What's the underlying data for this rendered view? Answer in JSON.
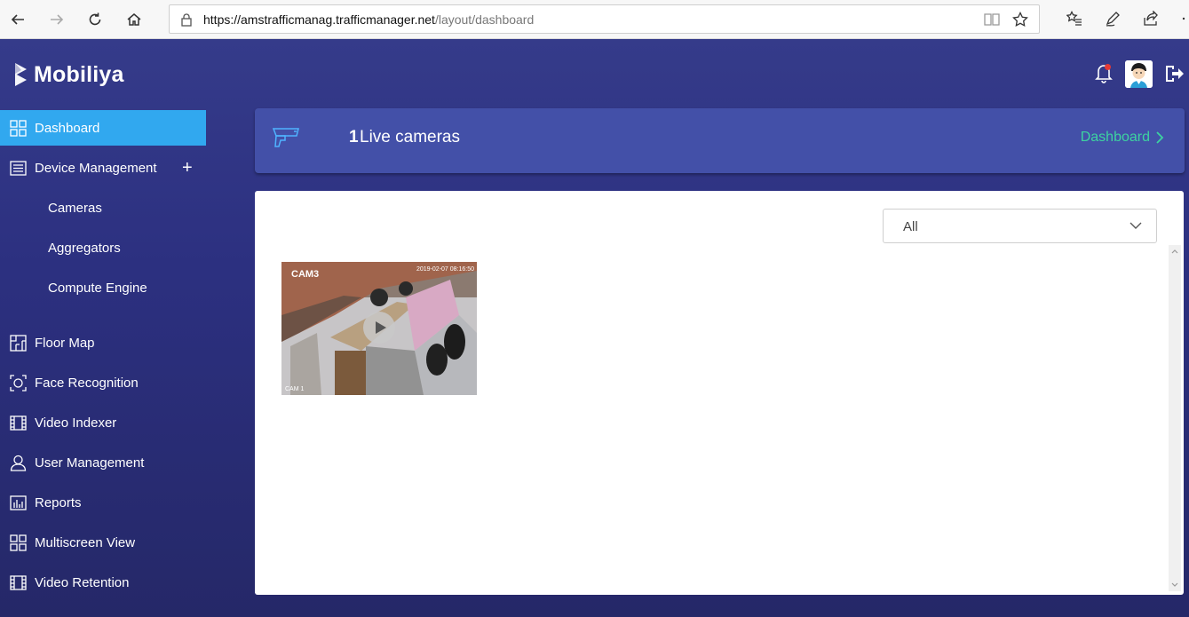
{
  "browser": {
    "url_host": "https://amstrafficmanag.trafficmanager.net",
    "url_path": "/layout/dashboard"
  },
  "app": {
    "logo_text": "Mobiliya"
  },
  "sidebar": {
    "items": [
      {
        "label": "Dashboard",
        "icon": "grid-icon",
        "active": true
      },
      {
        "label": "Device Management",
        "icon": "list-icon",
        "expand": "+"
      },
      {
        "label": "Cameras",
        "sub": true
      },
      {
        "label": "Aggregators",
        "sub": true
      },
      {
        "label": "Compute Engine",
        "sub": true
      },
      {
        "label": "Floor Map",
        "icon": "floor-map-icon"
      },
      {
        "label": "Face Recognition",
        "icon": "face-recognition-icon"
      },
      {
        "label": "Video Indexer",
        "icon": "film-icon"
      },
      {
        "label": "User Management",
        "icon": "user-icon"
      },
      {
        "label": "Reports",
        "icon": "bar-chart-icon"
      },
      {
        "label": "Multiscreen View",
        "icon": "grid-icon"
      },
      {
        "label": "Video Retention",
        "icon": "film-icon"
      }
    ]
  },
  "header": {
    "live_count": "1",
    "live_label": "Live cameras",
    "dashboard_link": "Dashboard"
  },
  "content": {
    "filter_value": "All",
    "cameras": [
      {
        "label": "CAM3",
        "timestamp": "2019-02-07 08:16:50",
        "footer": "CAM 1"
      }
    ]
  },
  "colors": {
    "active_item": "#31a8ef",
    "header_card": "#4350a8",
    "link": "#3dd3a0",
    "notification_dot": "#e53935"
  }
}
